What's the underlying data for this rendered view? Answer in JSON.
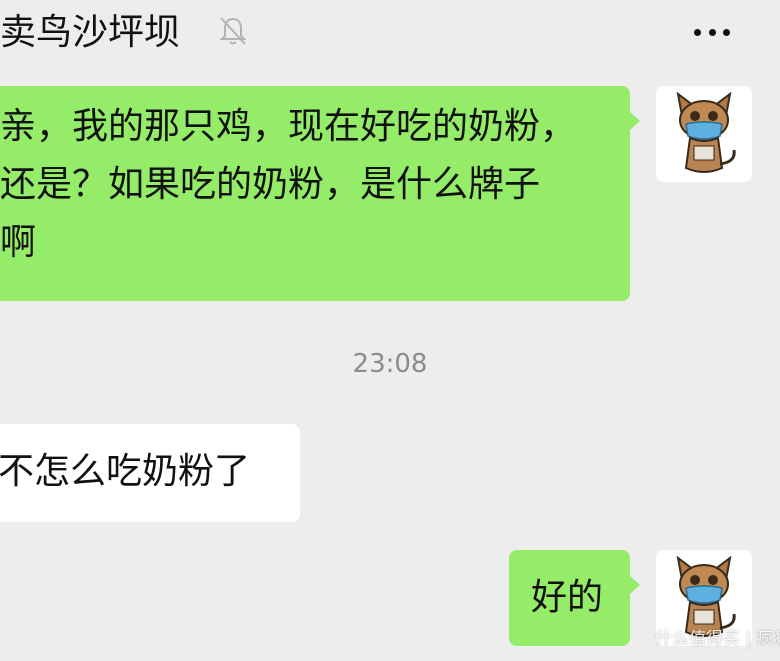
{
  "header": {
    "title": "卖鸟沙坪坝",
    "mute_icon": "bell-off-icon",
    "more_icon": "more-dots-icon"
  },
  "messages": [
    {
      "side": "right",
      "lines": [
        "亲，我的那只鸡，现在好吃的奶粉，",
        "还是？如果吃的奶粉，是什么牌子",
        "啊"
      ]
    },
    {
      "timestamp": "23:08"
    },
    {
      "side": "left",
      "text": "不怎么吃奶粉了"
    },
    {
      "side": "right",
      "text": "好的"
    }
  ],
  "avatar_icon": "cat-with-mask-avatar",
  "watermark": "什么值得买 | 疯狂",
  "colors": {
    "background": "#ededed",
    "sent_bubble": "#95ec69",
    "received_bubble": "#ffffff",
    "timestamp": "#8c8c8c"
  }
}
